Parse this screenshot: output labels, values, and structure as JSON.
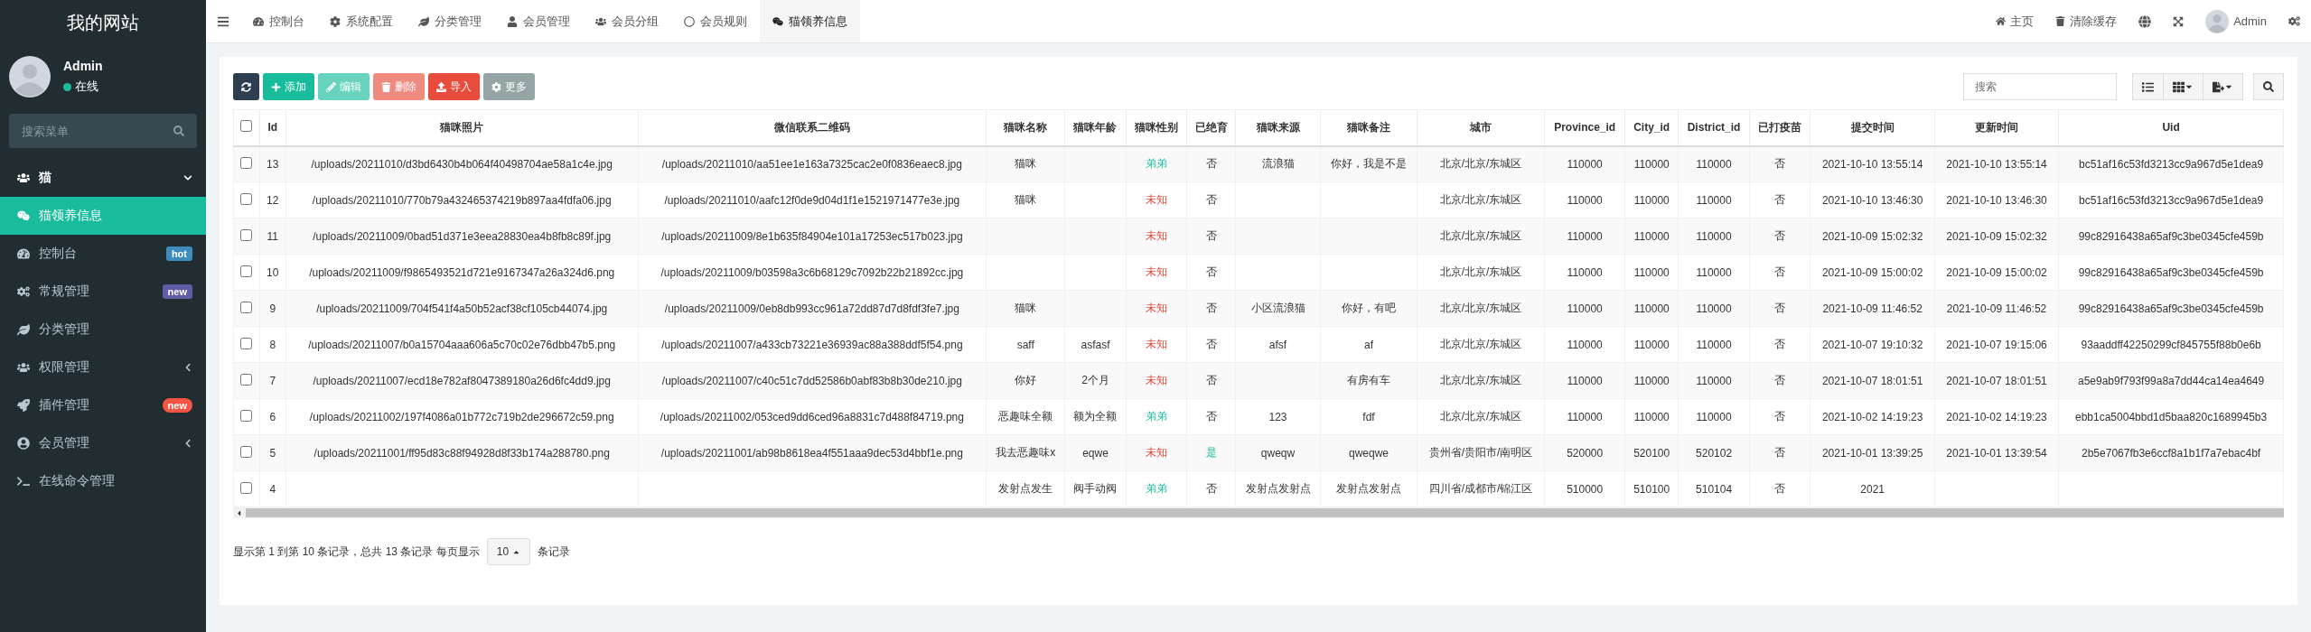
{
  "sidebar": {
    "logo": "我的网站",
    "user": {
      "name": "Admin",
      "status": "在线"
    },
    "search": {
      "placeholder": "搜索菜单"
    },
    "items": [
      {
        "label": "猫",
        "selected": false,
        "expanded": true,
        "children": [
          {
            "label": "猫领养信息",
            "selected": true
          }
        ]
      },
      {
        "label": "控制台",
        "selected": false,
        "badge": {
          "text": "hot",
          "kind": "label",
          "color": "#3c8dbc"
        }
      },
      {
        "label": "常规管理",
        "selected": false,
        "badge": {
          "text": "new",
          "kind": "label",
          "color": "#605ca8"
        }
      },
      {
        "label": "分类管理",
        "selected": false
      },
      {
        "label": "权限管理",
        "selected": false,
        "expanded": false
      },
      {
        "label": "插件管理",
        "selected": false,
        "badge": {
          "text": "new",
          "kind": "pill",
          "color": "#f75444"
        }
      },
      {
        "label": "会员管理",
        "selected": false,
        "expanded": false
      },
      {
        "label": "在线命令管理",
        "selected": false
      }
    ]
  },
  "topbar": {
    "tabs": [
      {
        "label": "控制台",
        "selected": false
      },
      {
        "label": "系统配置",
        "selected": false
      },
      {
        "label": "分类管理",
        "selected": false
      },
      {
        "label": "会员管理",
        "selected": false
      },
      {
        "label": "会员分组",
        "selected": false
      },
      {
        "label": "会员规则",
        "selected": false
      },
      {
        "label": "猫领养信息",
        "selected": true
      }
    ],
    "links": [
      {
        "label": "主页"
      },
      {
        "label": "清除缓存"
      }
    ],
    "user": "Admin"
  },
  "toolbar": {
    "buttons": [
      {
        "label": "添加",
        "kind": "success",
        "disabled": false
      },
      {
        "label": "编辑",
        "kind": "success",
        "disabled": true
      },
      {
        "label": "删除",
        "kind": "danger",
        "disabled": true
      },
      {
        "label": "导入",
        "kind": "danger",
        "disabled": false
      },
      {
        "label": "更多",
        "kind": "default",
        "disabled": false
      }
    ],
    "search": {
      "placeholder": "搜索"
    }
  },
  "table": {
    "header_checked": false,
    "columns": [
      "Id",
      "猫咪照片",
      "微信联系二维码",
      "猫咪名称",
      "猫咪年龄",
      "猫咪性别",
      "已绝育",
      "猫咪来源",
      "猫咪备注",
      "城市",
      "Province_id",
      "City_id",
      "District_id",
      "已打疫苗",
      "提交时间",
      "更新时间",
      "Uid"
    ],
    "rows": [
      {
        "checked": false,
        "id": "13",
        "photo": "/uploads/20211010/d3bd6430b4b064f40498704ae58a1c4e.jpg",
        "qr": "/uploads/20211010/aa51ee1e163a7325cac2e0f0836eaec8.jpg",
        "name": "猫咪",
        "gender": {
          "text": "弟弟",
          "kind": "male"
        },
        "sterilized": {
          "text": "否",
          "kind": "no"
        },
        "source": "流浪猫",
        "note": "你好，我是不是",
        "city": "北京/北京/东城区",
        "province_id": "110000",
        "city_id": "110000",
        "district_id": "110000",
        "vaccinated": "否",
        "submitted": "2021-10-10 13:55:14",
        "updated": "2021-10-10 13:55:14",
        "uid": "bc51af16c53fd3213cc9a967d5e1dea9"
      },
      {
        "checked": false,
        "id": "12",
        "photo": "/uploads/20211010/770b79a432465374219b897aa4fdfa06.jpg",
        "qr": "/uploads/20211010/aafc12f0de9d04d1f1e1521971477e3e.jpg",
        "name": "猫咪",
        "gender": {
          "text": "未知",
          "kind": "unknown"
        },
        "sterilized": {
          "text": "否",
          "kind": "no"
        },
        "city": "北京/北京/东城区",
        "province_id": "110000",
        "city_id": "110000",
        "district_id": "110000",
        "vaccinated": "否",
        "submitted": "2021-10-10 13:46:30",
        "updated": "2021-10-10 13:46:30",
        "uid": "bc51af16c53fd3213cc9a967d5e1dea9"
      },
      {
        "checked": false,
        "id": "11",
        "photo": "/uploads/20211009/0bad51d371e3eea28830ea4b8fb8c89f.jpg",
        "qr": "/uploads/20211009/8e1b635f84904e101a17253ec517b023.jpg",
        "gender": {
          "text": "未知",
          "kind": "unknown"
        },
        "sterilized": {
          "text": "否",
          "kind": "no"
        },
        "city": "北京/北京/东城区",
        "province_id": "110000",
        "city_id": "110000",
        "district_id": "110000",
        "vaccinated": "否",
        "submitted": "2021-10-09 15:02:32",
        "updated": "2021-10-09 15:02:32",
        "uid": "99c82916438a65af9c3be0345cfe459b"
      },
      {
        "checked": false,
        "id": "10",
        "photo": "/uploads/20211009/f9865493521d721e9167347a26a324d6.png",
        "qr": "/uploads/20211009/b03598a3c6b68129c7092b22b21892cc.jpg",
        "gender": {
          "text": "未知",
          "kind": "unknown"
        },
        "sterilized": {
          "text": "否",
          "kind": "no"
        },
        "city": "北京/北京/东城区",
        "province_id": "110000",
        "city_id": "110000",
        "district_id": "110000",
        "vaccinated": "否",
        "submitted": "2021-10-09 15:00:02",
        "updated": "2021-10-09 15:00:02",
        "uid": "99c82916438a65af9c3be0345cfe459b"
      },
      {
        "checked": false,
        "id": "9",
        "photo": "/uploads/20211009/704f541f4a50b52acf38cf105cb44074.jpg",
        "qr": "/uploads/20211009/0eb8db993cc961a72dd87d7d8fdf3fe7.jpg",
        "name": "猫咪",
        "gender": {
          "text": "未知",
          "kind": "unknown"
        },
        "sterilized": {
          "text": "否",
          "kind": "no"
        },
        "source": "小区流浪猫",
        "note": "你好，有吧",
        "city": "北京/北京/东城区",
        "province_id": "110000",
        "city_id": "110000",
        "district_id": "110000",
        "vaccinated": "否",
        "submitted": "2021-10-09 11:46:52",
        "updated": "2021-10-09 11:46:52",
        "uid": "99c82916438a65af9c3be0345cfe459b"
      },
      {
        "checked": false,
        "id": "8",
        "photo": "/uploads/20211007/b0a15704aaa606a5c70c02e76dbb47b5.png",
        "qr": "/uploads/20211007/a433cb73221e36939ac88a388ddf5f54.png",
        "name": "saff",
        "age": "asfasf",
        "gender": {
          "text": "未知",
          "kind": "unknown"
        },
        "sterilized": {
          "text": "否",
          "kind": "no"
        },
        "source": "afsf",
        "note": "af",
        "city": "北京/北京/东城区",
        "province_id": "110000",
        "city_id": "110000",
        "district_id": "110000",
        "vaccinated": "否",
        "submitted": "2021-10-07 19:10:32",
        "updated": "2021-10-07 19:15:06",
        "uid": "93aaddff42250299cf845755f88b0e6b"
      },
      {
        "checked": false,
        "id": "7",
        "photo": "/uploads/20211007/ecd18e782af8047389180a26d6fc4dd9.jpg",
        "qr": "/uploads/20211007/c40c51c7dd52586b0abf83b8b30de210.jpg",
        "name": "你好",
        "age": "2个月",
        "gender": {
          "text": "未知",
          "kind": "unknown"
        },
        "sterilized": {
          "text": "否",
          "kind": "no"
        },
        "note": "有房有车",
        "city": "北京/北京/东城区",
        "province_id": "110000",
        "city_id": "110000",
        "district_id": "110000",
        "vaccinated": "否",
        "submitted": "2021-10-07 18:01:51",
        "updated": "2021-10-07 18:01:51",
        "uid": "a5e9ab9f793f99a8a7dd44ca14ea4649"
      },
      {
        "checked": false,
        "id": "6",
        "photo": "/uploads/20211002/197f4086a01b772c719b2de296672c59.png",
        "qr": "/uploads/20211002/053ced9dd6ced96a8831c7d488f84719.png",
        "name": "恶趣味全额",
        "age": "额为全额",
        "gender": {
          "text": "弟弟",
          "kind": "male"
        },
        "sterilized": {
          "text": "否",
          "kind": "no"
        },
        "source": "123",
        "note": "fdf",
        "city": "北京/北京/东城区",
        "province_id": "110000",
        "city_id": "110000",
        "district_id": "110000",
        "vaccinated": "否",
        "submitted": "2021-10-02 14:19:23",
        "updated": "2021-10-02 14:19:23",
        "uid": "ebb1ca5004bbd1d5baa820c1689945b3"
      },
      {
        "checked": false,
        "id": "5",
        "photo": "/uploads/20211001/ff95d83c88f94928d8f33b174a288780.png",
        "qr": "/uploads/20211001/ab98b8618ea4f551aaa9dec53d4bbf1e.png",
        "name": "我去恶趣味x",
        "age": "eqwe",
        "gender": {
          "text": "未知",
          "kind": "unknown"
        },
        "sterilized": {
          "text": "是",
          "kind": "yes"
        },
        "source": "qweqw",
        "note": "qweqwe",
        "city": "贵州省/贵阳市/南明区",
        "province_id": "520000",
        "city_id": "520100",
        "district_id": "520102",
        "vaccinated": "否",
        "submitted": "2021-10-01 13:39:25",
        "updated": "2021-10-01 13:39:54",
        "uid": "2b5e7067fb3e6ccf8a1b1f7a7ebac4bf"
      },
      {
        "checked": false,
        "id": "4",
        "name": "发射点发生",
        "age": "阀手动阀",
        "gender": {
          "text": "弟弟",
          "kind": "male"
        },
        "sterilized": {
          "text": "否",
          "kind": "no"
        },
        "source": "发射点发射点",
        "note": "发射点发射点",
        "city": "四川省/成都市/锦江区",
        "province_id": "510000",
        "city_id": "510100",
        "district_id": "510104",
        "vaccinated": "否",
        "submitted": "2021"
      }
    ]
  },
  "pagination": {
    "summary": "显示第 1 到第 10 条记录，总共 13 条记录 每页显示",
    "page_size": "10",
    "suffix": "条记录"
  }
}
